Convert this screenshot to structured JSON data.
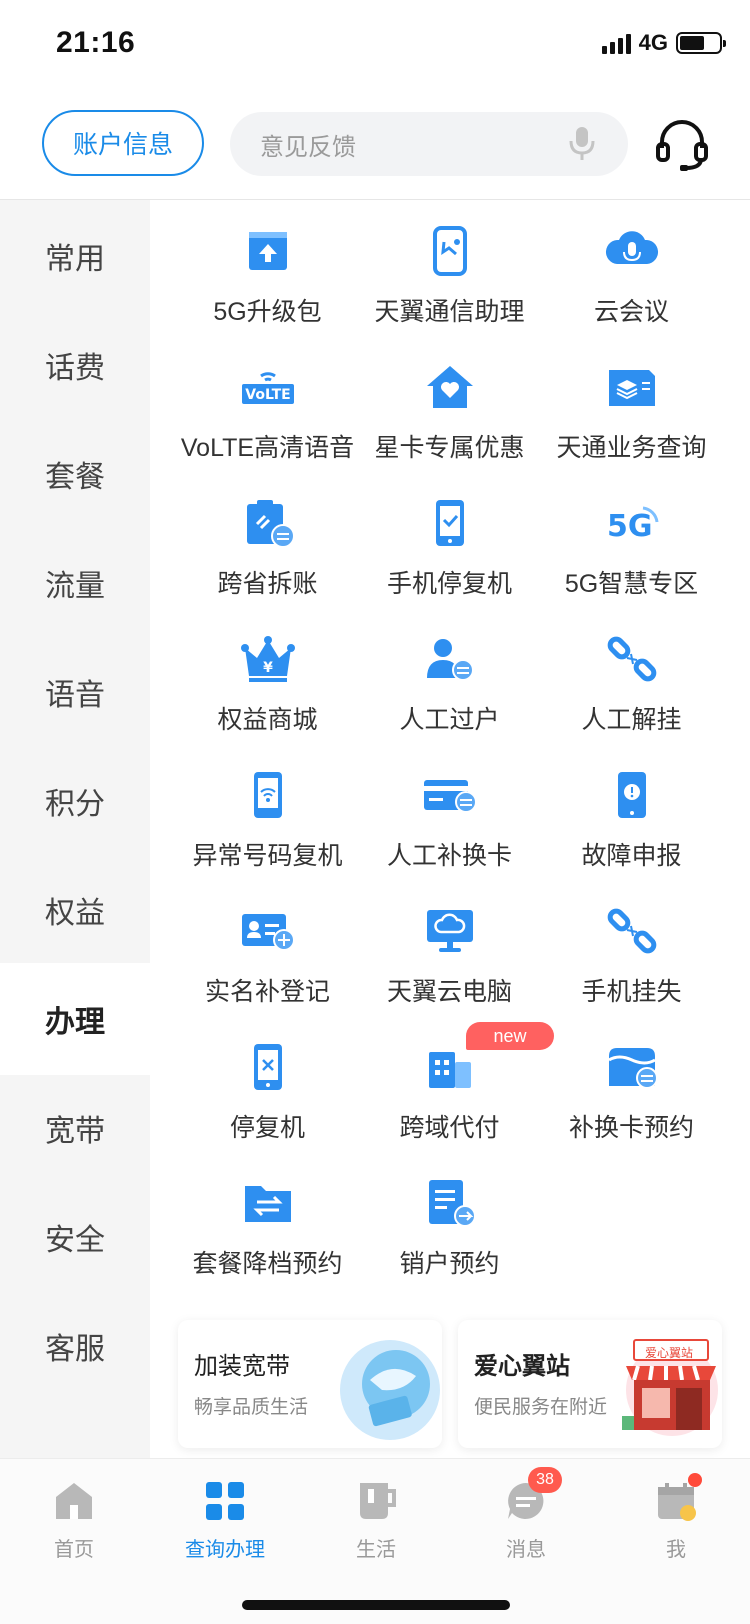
{
  "status": {
    "time": "21:16",
    "network": "4G"
  },
  "header": {
    "account_label": "账户信息",
    "search_placeholder": "意见反馈"
  },
  "sidebar": {
    "items": [
      {
        "label": "常用"
      },
      {
        "label": "话费"
      },
      {
        "label": "套餐"
      },
      {
        "label": "流量"
      },
      {
        "label": "语音"
      },
      {
        "label": "积分"
      },
      {
        "label": "权益"
      },
      {
        "label": "办理",
        "active": true
      },
      {
        "label": "宽带"
      },
      {
        "label": "安全"
      },
      {
        "label": "客服"
      }
    ]
  },
  "services": [
    {
      "label": "5G升级包",
      "icon": "upgrade-box-icon"
    },
    {
      "label": "天翼通信助理",
      "icon": "assistant-phone-icon"
    },
    {
      "label": "云会议",
      "icon": "cloud-mic-icon"
    },
    {
      "label": "VoLTE高清语音",
      "icon": "volte-icon"
    },
    {
      "label": "星卡专属优惠",
      "icon": "heart-house-icon"
    },
    {
      "label": "天通业务查询",
      "icon": "layers-card-icon"
    },
    {
      "label": "跨省拆账",
      "icon": "clipboard-transfer-icon"
    },
    {
      "label": "手机停复机",
      "icon": "phone-check-icon"
    },
    {
      "label": "5G智慧专区",
      "icon": "5g-logo-icon"
    },
    {
      "label": "权益商城",
      "icon": "crown-yen-icon"
    },
    {
      "label": "人工过户",
      "icon": "person-transfer-icon"
    },
    {
      "label": "人工解挂",
      "icon": "link-unlock-icon"
    },
    {
      "label": "异常号码复机",
      "icon": "phone-signal-icon"
    },
    {
      "label": "人工补换卡",
      "icon": "card-transfer-icon"
    },
    {
      "label": "故障申报",
      "icon": "phone-alert-icon"
    },
    {
      "label": "实名补登记",
      "icon": "id-card-add-icon"
    },
    {
      "label": "天翼云电脑",
      "icon": "cloud-computer-icon"
    },
    {
      "label": "手机挂失",
      "icon": "link-lost-icon"
    },
    {
      "label": "停复机",
      "icon": "phone-x-icon"
    },
    {
      "label": "跨域代付",
      "icon": "building-pay-icon",
      "badge": "new"
    },
    {
      "label": "补换卡预约",
      "icon": "box-transfer-icon"
    },
    {
      "label": "套餐降档预约",
      "icon": "folder-swap-icon"
    },
    {
      "label": "销户预约",
      "icon": "document-arrow-icon"
    }
  ],
  "promos": [
    {
      "title": "加装宽带",
      "subtitle": "畅享品质生活"
    },
    {
      "title": "爱心翼站",
      "subtitle": "便民服务在附近",
      "sign_text": "爱心翼站"
    }
  ],
  "tabbar": {
    "items": [
      {
        "label": "首页"
      },
      {
        "label": "查询办理",
        "active": true
      },
      {
        "label": "生活"
      },
      {
        "label": "消息",
        "badge": "38"
      },
      {
        "label": "我"
      }
    ]
  },
  "colors": {
    "accent": "#1a8be8",
    "icon_blue": "#2e8ff0",
    "badge_red": "#ff5a4e",
    "new_badge": "#ff6160"
  }
}
